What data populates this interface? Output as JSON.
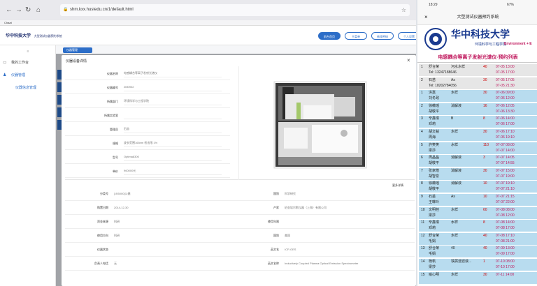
{
  "browser": {
    "address": "shm.kxx.hustedu.cn/1/default.html",
    "bookmark": "Chaat"
  },
  "header": {
    "logo_text": "华中科技大学",
    "logo_sub": "大型测试仪器预约系统",
    "buttons": [
      "前台首页",
      "主菜单",
      "修改密码",
      "个人设置"
    ]
  },
  "sidebar": {
    "items": [
      "我的工作台",
      "仪器管理",
      "仪器信息管理"
    ]
  },
  "tabs": [
    "仪器管理"
  ],
  "modal": {
    "title": "仪器设备详情",
    "close": "×",
    "more_link": "更多详情",
    "fields": [
      {
        "label": "仪器名称",
        "value": "电感耦合等离子发射光谱仪"
      },
      {
        "label": "仪器编号",
        "value": "2M0902"
      },
      {
        "label": "所属部门",
        "value": "环境科学与工程学院"
      },
      {
        "label": "所属实验室",
        "value": ""
      },
      {
        "label": "管理员",
        "value": "石苗"
      },
      {
        "label": "规格",
        "value": "波长范围165nm 检出限 1%"
      },
      {
        "label": "型号",
        "value": "Optima8300"
      },
      {
        "label": "单价",
        "value": "960000元"
      }
    ],
    "details": [
      {
        "l1": "分类号",
        "v1": "[ 8/5000]公墓",
        "l2": "国别",
        "v2": "科学研究"
      },
      {
        "l1": "购置日期",
        "v1": "2014-12-30",
        "l2": "产家",
        "v2": "珀金埃尔默仪器（上海）有限公司"
      },
      {
        "l1": "资金来源",
        "v1": "科研",
        "l2": "使用年限",
        "v2": ""
      },
      {
        "l1": "使用方向",
        "v1": "科研",
        "l2": "国别",
        "v2": "美国"
      },
      {
        "l1": "仪器状态",
        "v1": "",
        "l2": "英文名",
        "v2": "ICP-OES"
      },
      {
        "l1": "负责人电话",
        "v1": "无",
        "l2": "英文名称",
        "v2": "Inductively Coupled Plasma Optical Emission Spectrometer"
      }
    ]
  },
  "phone": {
    "time": "18:29",
    "battery": "67%",
    "title": "大型测试仪器预约系统",
    "univ": "华中科技大学",
    "univ_en": "环境科学与工程学院",
    "univ_tag": "Environment + E",
    "subtitle": "电感耦合等离子发射光谱仪-预约列表",
    "rows": [
      {
        "n": "1",
        "a": "舒合荣",
        "b": "河水水样",
        "c": "40",
        "d": "07-05 13:00",
        "e": "07-05 17:00",
        "tel": "Tel: 13247188646",
        "cls": "gr"
      },
      {
        "n": "2",
        "a": "石苗",
        "b": "As",
        "c": "30",
        "d": "07-05 17:05",
        "e": "07-05 21:30",
        "tel": "Tel: 18202784056",
        "cls": "gr"
      },
      {
        "n": "1",
        "a": "洪嘉",
        "b": "水样",
        "c": "30",
        "d": "07-06 09:00",
        "e": "07-06 12:00",
        "tel": "刘冬政",
        "cls": "bl"
      },
      {
        "n": "2",
        "a": "徐薇瑶",
        "b": "消解液",
        "c": "16",
        "d": "07-06 12:05",
        "e": "07-06 13:30",
        "tel": "胡敬平",
        "cls": "bl"
      },
      {
        "n": "3",
        "a": "辛鑫琪",
        "b": "B",
        "c": "8",
        "d": "07-06 14:00",
        "e": "07-06 17:00",
        "tel": "邓莉",
        "cls": "bl"
      },
      {
        "n": "4",
        "a": "胡文韬",
        "b": "水样",
        "c": "30",
        "d": "07-06 17:10",
        "e": "07-06 19:10",
        "tel": "周海",
        "cls": "bl"
      },
      {
        "n": "5",
        "a": "許笑笑",
        "b": "水样",
        "c": "110",
        "d": "07-07 08:00",
        "e": "07-07 14:00",
        "tel": "梁莎",
        "cls": "bl"
      },
      {
        "n": "6",
        "a": "周晶晶",
        "b": "消解液",
        "c": "3",
        "d": "07-07 14:05",
        "e": "07-07 14:55",
        "tel": "胡敬平",
        "cls": "bl"
      },
      {
        "n": "7",
        "a": "张家皓",
        "b": "消解液",
        "c": "30",
        "d": "07-07 15:00",
        "e": "07-07 19:00",
        "tel": "胡智泉",
        "cls": "bl"
      },
      {
        "n": "8",
        "a": "徐薇瑶",
        "b": "消解液",
        "c": "10",
        "d": "07-07 19:10",
        "e": "07-07 21:10",
        "tel": "胡敬平",
        "cls": "bl"
      },
      {
        "n": "9",
        "a": "石苗",
        "b": "As",
        "c": "10",
        "d": "07-07 21:15",
        "e": "07-07 22:00",
        "tel": "王琳玲",
        "cls": "bl"
      },
      {
        "n": "10",
        "a": "文明桂",
        "b": "水样",
        "c": "60",
        "d": "07-08 08:00",
        "e": "07-08 12:00",
        "tel": "梁莎",
        "cls": "bl"
      },
      {
        "n": "11",
        "a": "辛鑫琪",
        "b": "水样",
        "c": "8",
        "d": "07-08 14:00",
        "e": "07-08 17:00",
        "tel": "邓莉",
        "cls": "bl"
      },
      {
        "n": "12",
        "a": "舒合荣",
        "b": "水样",
        "c": "40",
        "d": "07-08 17:10",
        "e": "07-08 21:00",
        "tel": "毛娟",
        "cls": "bl"
      },
      {
        "n": "13",
        "a": "舒合荣",
        "b": "40",
        "c": "40",
        "d": "07-09 13:00",
        "e": "07-09 17:00",
        "tel": "毛娟",
        "cls": "bl"
      },
      {
        "n": "14",
        "a": "杨帆",
        "b": "铁屑浸滤液...",
        "c": "1",
        "d": "07-10 08:00",
        "e": "07-10 17:00",
        "tel": "梁莎",
        "cls": "bl"
      },
      {
        "n": "15",
        "a": "喻心明",
        "b": "水样",
        "c": "30",
        "d": "07-11 14:00",
        "e": "",
        "tel": "",
        "cls": "bl"
      }
    ]
  }
}
